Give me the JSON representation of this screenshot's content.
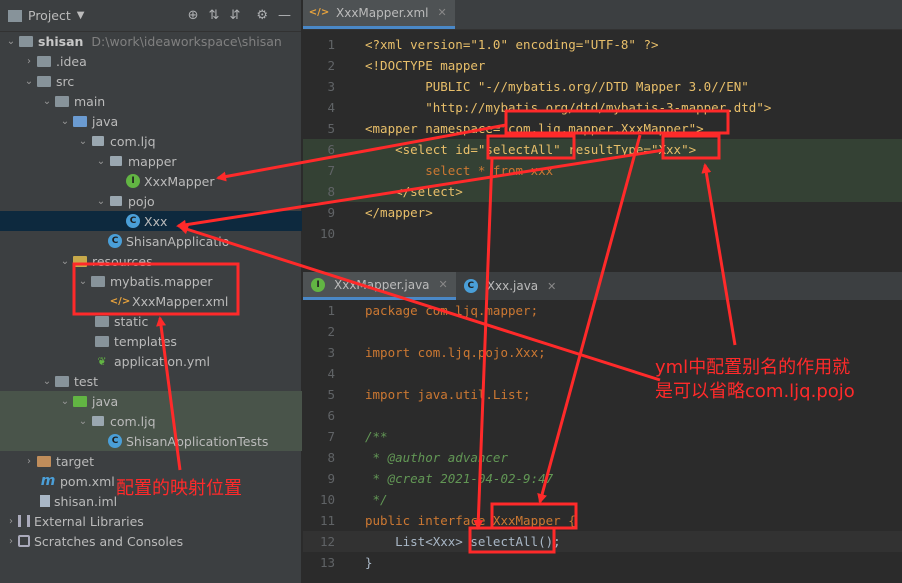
{
  "project_panel": {
    "title": "Project",
    "tool_icons": [
      "target-icon",
      "expand-icon",
      "collapse-icon",
      "gear-icon",
      "minimize-icon"
    ],
    "tree": [
      {
        "label": "shisan",
        "path": "D:\\work\\ideaworkspace\\shisan"
      },
      {
        "label": ".idea"
      },
      {
        "label": "src"
      },
      {
        "label": "main"
      },
      {
        "label": "java"
      },
      {
        "label": "com.ljq"
      },
      {
        "label": "mapper"
      },
      {
        "label": "XxxMapper"
      },
      {
        "label": "pojo"
      },
      {
        "label": "Xxx"
      },
      {
        "label": "ShisanApplicatio"
      },
      {
        "label": "resources"
      },
      {
        "label": "mybatis.mapper"
      },
      {
        "label": "XxxMapper.xml"
      },
      {
        "label": "static"
      },
      {
        "label": "templates"
      },
      {
        "label": "application.yml"
      },
      {
        "label": "test"
      },
      {
        "label": "java"
      },
      {
        "label": "com.ljq"
      },
      {
        "label": "ShisanApplicationTests"
      },
      {
        "label": "target"
      },
      {
        "label": "pom.xml"
      },
      {
        "label": "shisan.iml"
      },
      {
        "label": "External Libraries"
      },
      {
        "label": "Scratches and Consoles"
      }
    ]
  },
  "editor_top": {
    "tab": "XxxMapper.xml",
    "lines": [
      {
        "n": "1",
        "t": "<?xml version=\"1.0\" encoding=\"UTF-8\" ?>"
      },
      {
        "n": "2",
        "t": "<!DOCTYPE mapper"
      },
      {
        "n": "3",
        "t": "        PUBLIC \"-//mybatis.org//DTD Mapper 3.0//EN\""
      },
      {
        "n": "4",
        "t": "        \"http://mybatis.org/dtd/mybatis-3-mapper.dtd\">"
      },
      {
        "n": "5",
        "t": "<mapper namespace=\"com.ljq.mapper.XxxMapper\">"
      },
      {
        "n": "6",
        "t": "    <select id=\"selectAll\" resultType=\"Xxx\">"
      },
      {
        "n": "7",
        "t": "        select * from xxx"
      },
      {
        "n": "8",
        "t": "    </select>"
      },
      {
        "n": "9",
        "t": "</mapper>"
      },
      {
        "n": "10",
        "t": ""
      }
    ]
  },
  "editor_bottom": {
    "tabs": [
      "XxxMapper.java",
      "Xxx.java"
    ],
    "lines": [
      {
        "n": "1",
        "t": "package com.ljq.mapper;"
      },
      {
        "n": "2",
        "t": ""
      },
      {
        "n": "3",
        "t": "import com.ljq.pojo.Xxx;"
      },
      {
        "n": "4",
        "t": ""
      },
      {
        "n": "5",
        "t": "import java.util.List;"
      },
      {
        "n": "6",
        "t": ""
      },
      {
        "n": "7",
        "t": "/**"
      },
      {
        "n": "8",
        "t": " * @author advancer"
      },
      {
        "n": "9",
        "t": " * @creat 2021-04-02-9:47"
      },
      {
        "n": "10",
        "t": " */"
      },
      {
        "n": "11",
        "t": "public interface XxxMapper {"
      },
      {
        "n": "12",
        "t": "    List<Xxx> selectAll();"
      },
      {
        "n": "13",
        "t": "}"
      }
    ]
  },
  "annotations": {
    "alias_note_line1": "yml中配置别名的作用就",
    "alias_note_line2": "是可以省略com.ljq.pojo",
    "location_note": "配置的映射位置",
    "color": "#ff2a2a"
  }
}
